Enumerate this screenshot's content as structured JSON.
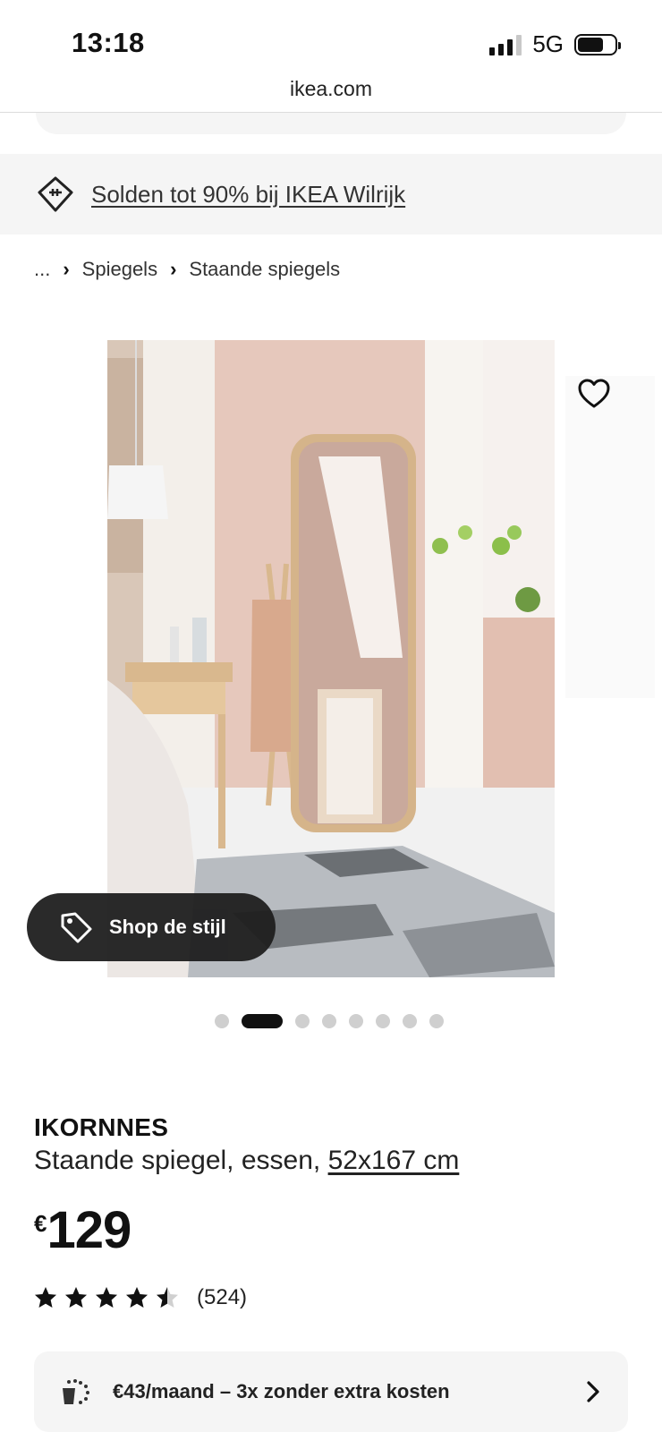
{
  "status_bar": {
    "time": "13:18",
    "network": "5G",
    "battery_level": 0.7
  },
  "browser": {
    "url": "ikea.com"
  },
  "promo": {
    "text": "Solden tot 90% bij IKEA Wilrijk"
  },
  "breadcrumb": {
    "ellipsis": "...",
    "items": [
      "Spiegels",
      "Staande spiegels"
    ]
  },
  "gallery": {
    "shop_style_label": "Shop de stijl",
    "slide_count": 8,
    "active_slide": 2,
    "favorited": false
  },
  "product": {
    "name": "IKORNNES",
    "description": "Staande spiegel, essen, ",
    "size": "52x167 cm",
    "currency": "€",
    "price": "129",
    "rating": 4.5,
    "rating_max": 5,
    "review_count": "(524)"
  },
  "installment": {
    "text": "€43/maand – 3x zonder extra kosten"
  }
}
